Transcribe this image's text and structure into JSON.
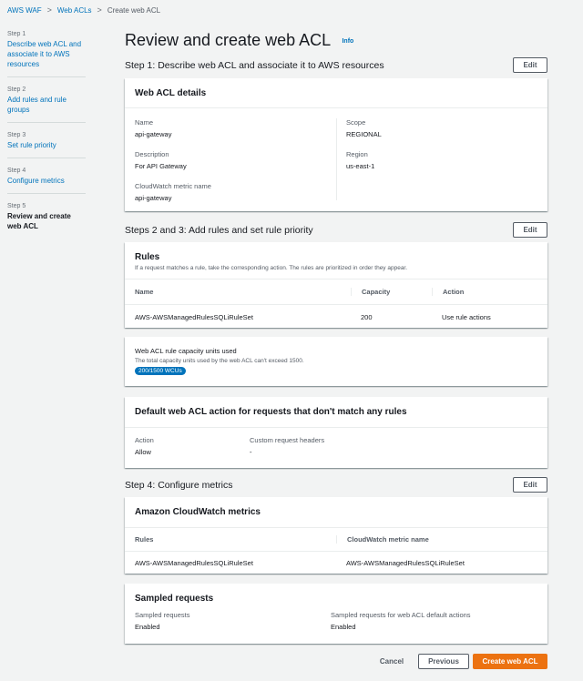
{
  "breadcrumb": {
    "items": [
      "AWS WAF",
      "Web ACLs",
      "Create web ACL"
    ]
  },
  "sidebar": {
    "steps": [
      {
        "num": "Step 1",
        "label": "Describe web ACL and associate it to AWS resources"
      },
      {
        "num": "Step 2",
        "label": "Add rules and rule groups"
      },
      {
        "num": "Step 3",
        "label": "Set rule priority"
      },
      {
        "num": "Step 4",
        "label": "Configure metrics"
      },
      {
        "num": "Step 5",
        "label": "Review and create web ACL"
      }
    ]
  },
  "page": {
    "title": "Review and create web ACL",
    "info": "Info"
  },
  "step1": {
    "title": "Step 1: Describe web ACL and associate it to AWS resources",
    "edit": "Edit",
    "card_title": "Web ACL details",
    "name_label": "Name",
    "name_value": "api-gateway",
    "description_label": "Description",
    "description_value": "For API Gateway",
    "metric_label": "CloudWatch metric name",
    "metric_value": "api-gateway",
    "scope_label": "Scope",
    "scope_value": "REGIONAL",
    "region_label": "Region",
    "region_value": "us-east-1"
  },
  "step23": {
    "title": "Steps 2 and 3: Add rules and set rule priority",
    "edit": "Edit",
    "card_title": "Rules",
    "card_desc": "If a request matches a rule, take the corresponding action. The rules are prioritized in order they appear.",
    "columns": [
      "Name",
      "Capacity",
      "Action"
    ],
    "rows": [
      {
        "name": "AWS-AWSManagedRulesSQLiRuleSet",
        "capacity": "200",
        "action": "Use rule actions"
      }
    ],
    "wcu_title": "Web ACL rule capacity units used",
    "wcu_desc": "The total capacity units used by the web ACL can't exceed 1500.",
    "wcu_badge": "200/1500 WCUs"
  },
  "default_action": {
    "title": "Default web ACL action for requests that don't match any rules",
    "action_label": "Action",
    "action_value": "Allow",
    "headers_label": "Custom request headers",
    "headers_value": "-"
  },
  "step4": {
    "title": "Step 4: Configure metrics",
    "edit": "Edit",
    "card_title": "Amazon CloudWatch metrics",
    "columns": [
      "Rules",
      "CloudWatch metric name"
    ],
    "rows": [
      {
        "rule": "AWS-AWSManagedRulesSQLiRuleSet",
        "metric": "AWS-AWSManagedRulesSQLiRuleSet"
      }
    ]
  },
  "sampled": {
    "title": "Sampled requests",
    "label1": "Sampled requests",
    "value1": "Enabled",
    "label2": "Sampled requests for web ACL default actions",
    "value2": "Enabled"
  },
  "footer": {
    "cancel": "Cancel",
    "previous": "Previous",
    "create": "Create web ACL"
  },
  "colors": {
    "link": "#0073bb",
    "primary_button": "#ec7211",
    "background": "#f2f3f3"
  }
}
